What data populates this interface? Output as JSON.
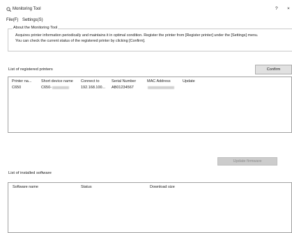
{
  "window": {
    "title": "Monitoring Tool",
    "help_glyph": "?",
    "close_glyph": "×"
  },
  "menu": {
    "items": [
      {
        "label": "File(F)"
      },
      {
        "label": "Settings(S)"
      }
    ]
  },
  "about": {
    "legend": "About the Monitoring Tool",
    "line1": "Acquires printer information periodically and maintains it in optimal condition. Register the printer from [Register printer] under the [Settings] menu.",
    "line2": "You can check the current status of the registered printer by clicking [Confirm]."
  },
  "printers": {
    "title": "List of registered printers",
    "confirm_label": "Confirm",
    "update_firmware_label": "Update firmware",
    "columns": [
      "Printer na...",
      "Short device name",
      "Connect to",
      "Serial Number",
      "MAC Address",
      "Update"
    ],
    "rows": [
      {
        "printer_name": "C650",
        "short_device_name": "C650-",
        "connect_to": "192.168.100...",
        "serial_number": "AB01234567",
        "mac_address": "",
        "update": ""
      }
    ]
  },
  "software": {
    "title": "List of installed software",
    "columns": [
      "Software name",
      "Status",
      "Download size"
    ]
  }
}
